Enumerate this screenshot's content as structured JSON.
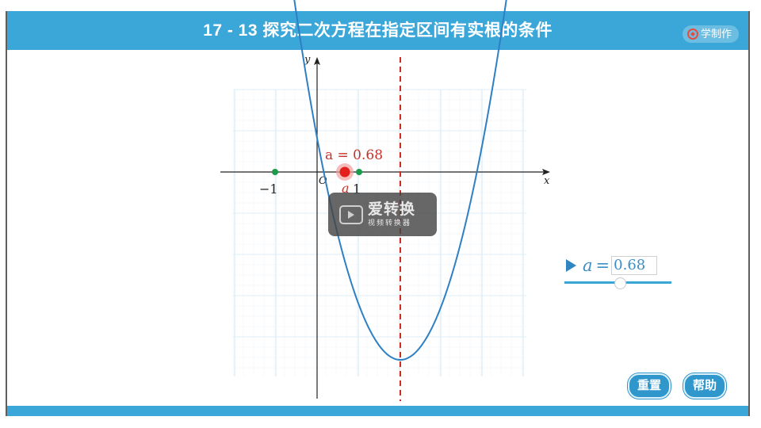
{
  "window": {
    "title": "17 - 13 探究二次方程在指定区间有实根的条件",
    "brand": "学制作"
  },
  "graph": {
    "x_axis_label": "x",
    "y_axis_label": "y",
    "origin_label": "O",
    "tick_labels": {
      "neg_one": "−1",
      "one": "1"
    },
    "point_label": "a",
    "value_label": "a = 0.68",
    "curve_color": "#2e7fc4",
    "dashed_line_color": "#d42a20",
    "point_color": "#e3201b",
    "endpoint_color": "#1a9a4a"
  },
  "slider": {
    "variable": "a",
    "equals": "=",
    "value": "0.68"
  },
  "buttons": {
    "reset": "重置",
    "help": "帮助"
  },
  "watermark": {
    "title": "爱转换",
    "subtitle": "视频转换器"
  },
  "colors": {
    "accent": "#3ba7d9",
    "button": "#2f97cc"
  }
}
